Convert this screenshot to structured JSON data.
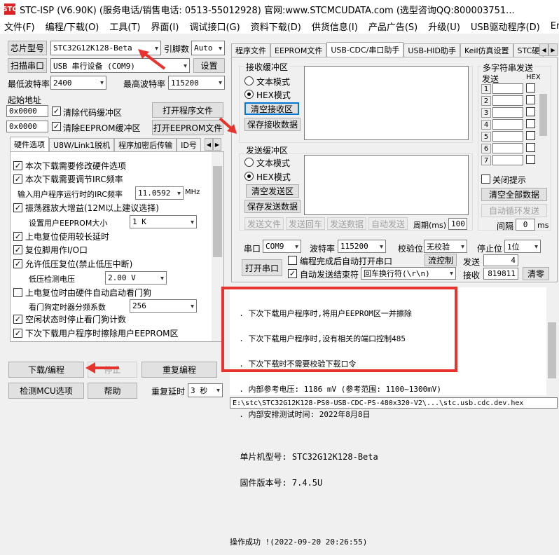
{
  "title": "STC-ISP (V6.90K) (服务电话/销售电话: 0513-55012928) 官网:www.STCMCUDATA.com  (选型咨询QQ:800003751...",
  "app_icon": "STC",
  "menu": [
    "文件(F)",
    "编程/下载(O)",
    "工具(T)",
    "界面(I)",
    "调试接口(G)",
    "资料下载(D)",
    "供货信息(I)",
    "产品广告(S)",
    "升级(U)",
    "USB驱动程序(D)",
    "English"
  ],
  "left": {
    "chip_btn": "芯片型号",
    "chip_value": "STC32G12K128-Beta",
    "pin_label": "引脚数",
    "pin_value": "Auto",
    "scan_btn": "扫描串口",
    "port_value": "USB 串行设备 (COM9)",
    "settings_btn": "设置",
    "min_baud_label": "最低波特率",
    "min_baud_value": "2400",
    "max_baud_label": "最高波特率",
    "max_baud_value": "115200",
    "start_addr_label": "起始地址",
    "addr1": "0x0000",
    "clear_code_label": "清除代码缓冲区",
    "open_prog_btn": "打开程序文件",
    "addr2": "0x0000",
    "clear_eeprom_label": "清除EEPROM缓冲区",
    "open_eeprom_btn": "打开EEPROM文件",
    "tabs": [
      "硬件选项",
      "U8W/Link1脱机",
      "程序加密后传输",
      "ID号"
    ],
    "hw_options": {
      "opt1": "本次下载需要修改硬件选项",
      "opt2": "本次下载需要调节IRC频率",
      "irc_label": "输入用户程序运行时的IRC频率",
      "irc_value": "11.0592",
      "irc_unit": "MHz",
      "opt3": "振荡器放大增益(12M以上建议选择)",
      "eeprom_size_label": "设置用户EEPROM大小",
      "eeprom_size_value": "1    K",
      "opt4": "上电复位使用较长延时",
      "opt5": "复位脚用作I/O口",
      "opt6": "允许低压复位(禁止低压中断)",
      "lvd_label": "低压检测电压",
      "lvd_value": "2.00 V",
      "opt7": "上电复位时由硬件自动启动看门狗",
      "wdt_label": "看门狗定时器分频系数",
      "wdt_value": "256",
      "opt8": "空闲状态时停止看门狗计数",
      "opt9": "下次下载用户程序时擦除用户EEPROM区"
    },
    "download_btn": "下载/编程",
    "stop_btn": "停止",
    "reprogram_btn": "重复编程",
    "check_mcu_btn": "检测MCU选项",
    "help_btn": "帮助",
    "repeat_delay_label": "重复延时",
    "repeat_delay_value": "3 秒"
  },
  "right": {
    "tabs": [
      "程序文件",
      "EEPROM文件",
      "USB-CDC/串口助手",
      "USB-HID助手",
      "Keil仿真设置",
      "STC硬"
    ],
    "recv_group": "接收缓冲区",
    "recv_text_mode": "文本模式",
    "recv_hex_mode": "HEX模式",
    "clear_recv_btn": "清空接收区",
    "save_recv_btn": "保存接收数据",
    "send_group": "发送缓冲区",
    "send_text_mode": "文本模式",
    "send_hex_mode": "HEX模式",
    "clear_send_btn": "清空发送区",
    "save_send_btn": "保存发送数据",
    "send_file_btn": "发送文件",
    "send_enter_btn": "发送回车",
    "send_data_btn": "发送数据",
    "auto_send_btn": "自动发送",
    "period_label": "周期(ms)",
    "period_value": "100",
    "multi_group": "多字符串发送",
    "multi_send_label": "发送",
    "multi_hex_label": "HEX",
    "rows": [
      "1",
      "2",
      "3",
      "4",
      "5",
      "6",
      "7"
    ],
    "close_tip_label": "关闭提示",
    "clear_all_btn": "清空全部数据",
    "auto_loop_btn": "自动循环发送",
    "interval_label": "间隔",
    "interval_value": "0",
    "interval_unit": "ms",
    "port_label": "串口",
    "port_value": "COM9",
    "baud_label": "波特率",
    "baud_value": "115200",
    "parity_label": "校验位",
    "parity_value": "无校验",
    "stop_label": "停止位",
    "stop_value": "1位",
    "open_port_btn": "打开串口",
    "auto_open_label": "编程完成后自动打开串口",
    "flow_ctrl_btn": "流控制",
    "send_count_label": "发送",
    "send_count": "4",
    "auto_send_end_label": "自动发送结束符",
    "end_char_value": "回车换行符(\\r\\n)",
    "recv_count_label": "接收",
    "recv_count": "819811",
    "clear_count_btn": "清零"
  },
  "log_lines": [
    "  . 下次下载用户程序时,将用户EEPROM区一并擦除",
    "  . 下次下载用户程序时,没有相关的端口控制485",
    "  . 下次下载时不需要校验下载口令",
    "  . 内部参考电压: 1186 mV (参考范围: 1100~1300mV)",
    "  . 内部安排测试时间: 2022年8月8日",
    "",
    "  单片机型号: STC32G12K128-Beta",
    "  固件版本号: 7.4.5U",
    "",
    "",
    "操作成功 !(2022-09-20 20:26:55)"
  ],
  "status_path": "E:\\stc\\STC32G12K128-PS0-USB-CDC-PS-480x320-V2\\...\\stc.usb.cdc.dev.hex"
}
